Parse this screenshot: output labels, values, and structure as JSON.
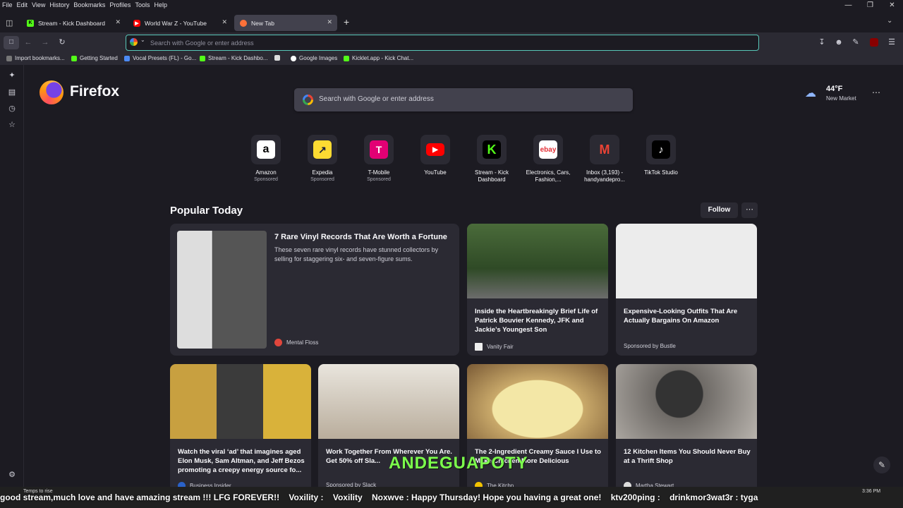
{
  "menubar": {
    "items": [
      "File",
      "Edit",
      "View",
      "History",
      "Bookmarks",
      "Profiles",
      "Tools",
      "Help"
    ]
  },
  "tabs": [
    {
      "title": "Stream - Kick Dashboard",
      "favicon": "kick-icon"
    },
    {
      "title": "World War Z - YouTube",
      "favicon": "youtube-icon"
    },
    {
      "title": "New Tab",
      "favicon": "firefox-icon",
      "active": true
    }
  ],
  "urlbar": {
    "placeholder": "Search with Google or enter address"
  },
  "bookmarks": [
    "Import bookmarks...",
    "Getting Started",
    "Vocal Presets (FL) - Go...",
    "Stream - Kick Dashbo...",
    "",
    "Google Images",
    "Kicklet.app - Kick Chat..."
  ],
  "newtab": {
    "brand": "Firefox",
    "search_placeholder": "Search with Google or enter address",
    "weather": {
      "temp": "44°F",
      "location": "New Market"
    },
    "shortcuts": [
      {
        "label": "Amazon",
        "sub": "Sponsored"
      },
      {
        "label": "Expedia",
        "sub": "Sponsored"
      },
      {
        "label": "T-Mobile",
        "sub": "Sponsored"
      },
      {
        "label": "YouTube",
        "sub": ""
      },
      {
        "label": "Stream - Kick Dashboard",
        "sub": ""
      },
      {
        "label": "Electronics, Cars, Fashion,...",
        "sub": ""
      },
      {
        "label": "Inbox (3,193) - handyandepro...",
        "sub": ""
      },
      {
        "label": "TikTok Studio",
        "sub": ""
      }
    ],
    "popular_title": "Popular Today",
    "follow_label": "Follow",
    "stories": [
      {
        "title": "7 Rare Vinyl Records That Are Worth a Fortune",
        "excerpt": "These seven rare vinyl records have stunned collectors by selling for staggering six- and seven-figure sums.",
        "source": "Mental Floss"
      },
      {
        "title": "Inside the Heartbreakingly Brief Life of Patrick Bouvier Kennedy, JFK and Jackie’s Youngest Son",
        "source": "Vanity Fair"
      },
      {
        "title": "Expensive-Looking Outfits That Are Actually Bargains On Amazon",
        "source": "Sponsored by Bustle"
      },
      {
        "title": "Watch the viral ‘ad’ that imagines aged Elon Musk, Sam Altman, and Jeff Bezos promoting a creepy energy source fo...",
        "source": "Business Insider"
      },
      {
        "title": "Work Together From Wherever You Are. Get 50% off Sla...",
        "source": "Sponsored by Slack"
      },
      {
        "title": "The 2-Ingredient Creamy Sauce I Use to Make Chicken More Delicious",
        "source": "The Kitchn"
      },
      {
        "title": "12 Kitchen Items You Should Never Buy at a Thrift Shop",
        "source": "Martha Stewart"
      }
    ]
  },
  "overlay": {
    "ticker": "good stream,much love and have amazing stream !!! LFG FOREVER!!    Voxility :    Voxility    Noxwve : Happy Thursday! Hope you having a great one!    ktv200ping :    drinkmor3wat3r : tyga",
    "username": "ANDEGUAPOTY",
    "temp_note": "Temps to rise",
    "clock": "3:36 PM"
  }
}
